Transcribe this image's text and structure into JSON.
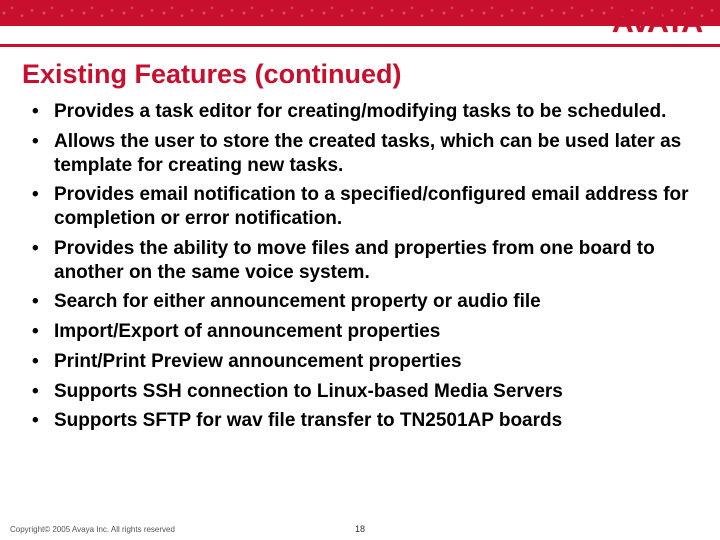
{
  "brand": {
    "logo_text": "AVAYA",
    "accent_color": "#c8102e"
  },
  "slide": {
    "title": "Existing Features (continued)",
    "bullets": [
      "Provides a task editor for creating/modifying tasks to be scheduled.",
      "Allows the user to store the created tasks, which can be used later as template for creating new tasks.",
      "Provides email notification to a specified/configured email address for completion or error notification.",
      "Provides the ability to move files and properties from one board to another on the same voice system.",
      "Search for either announcement property or audio file",
      "Import/Export of announcement properties",
      "Print/Print Preview announcement properties",
      "Supports SSH connection to Linux-based Media Servers",
      "Supports SFTP for wav file transfer to TN2501AP boards"
    ],
    "copyright": "Copyright© 2005 Avaya Inc. All rights reserved",
    "page_number": "18"
  }
}
